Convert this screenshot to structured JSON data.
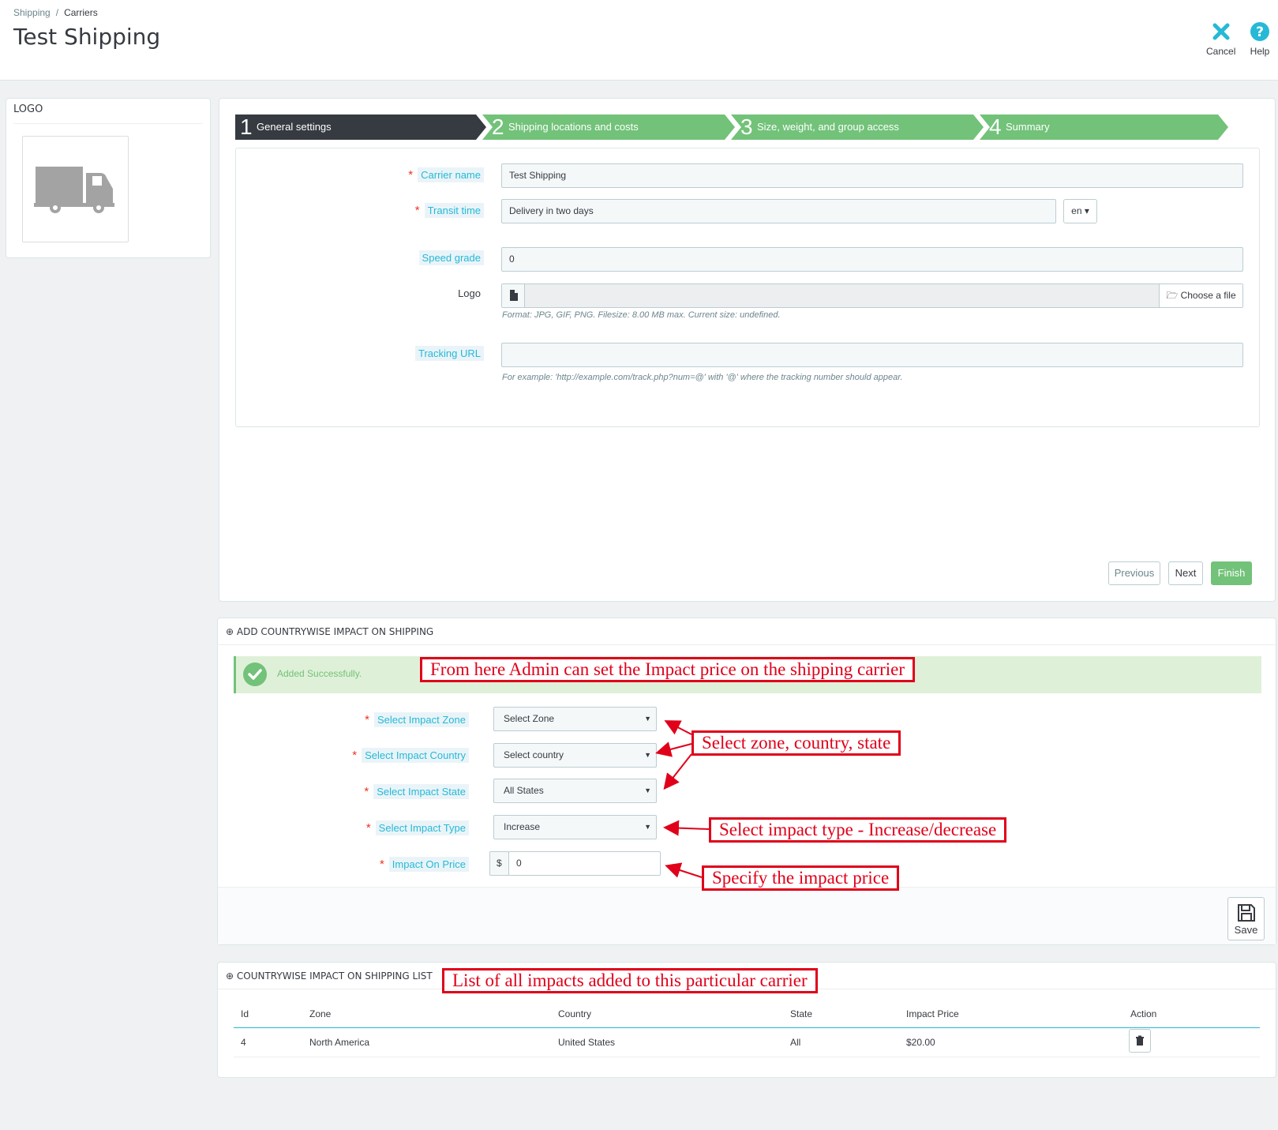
{
  "header": {
    "breadcrumb": [
      "Shipping",
      "Carriers"
    ],
    "breadcrumb_sep": "/",
    "title": "Test Shipping",
    "cancel_label": "Cancel",
    "help_label": "Help"
  },
  "logo_panel": {
    "title": "LOGO",
    "icon": "truck-icon"
  },
  "steps": [
    {
      "num": "1",
      "label": "General settings"
    },
    {
      "num": "2",
      "label": "Shipping locations and costs"
    },
    {
      "num": "3",
      "label": "Size, weight, and group access"
    },
    {
      "num": "4",
      "label": "Summary"
    }
  ],
  "form": {
    "carrier_name_label": "Carrier name",
    "carrier_name_value": "Test Shipping",
    "transit_time_label": "Transit time",
    "transit_time_value": "Delivery in two days",
    "lang": "en",
    "speed_grade_label": "Speed grade",
    "speed_grade_value": "0",
    "logo_label": "Logo",
    "choose_file": "Choose a file",
    "logo_hint": "Format: JPG, GIF, PNG. Filesize: 8.00 MB max. Current size: undefined.",
    "tracking_label": "Tracking URL",
    "tracking_value": "",
    "tracking_hint": "For example: 'http://example.com/track.php?num=@' with '@' where the tracking number should appear."
  },
  "wizard_buttons": {
    "previous": "Previous",
    "next": "Next",
    "finish": "Finish"
  },
  "impact": {
    "title": "ADD COUNTRYWISE IMPACT ON SHIPPING",
    "alert": "Added Successfully.",
    "zone_label": "Select Impact Zone",
    "zone_value": "Select Zone",
    "country_label": "Select Impact Country",
    "country_value": "Select country",
    "state_label": "Select Impact State",
    "state_value": "All States",
    "type_label": "Select Impact Type",
    "type_value": "Increase",
    "price_label": "Impact On Price",
    "currency": "$",
    "price_value": "0",
    "save": "Save"
  },
  "list": {
    "title": "COUNTRYWISE IMPACT ON SHIPPING LIST",
    "columns": [
      "Id",
      "Zone",
      "Country",
      "State",
      "Impact Price",
      "Action"
    ],
    "rows": [
      {
        "id": "4",
        "zone": "North America",
        "country": "United States",
        "state": "All",
        "price": "$20.00"
      }
    ]
  },
  "annotations": {
    "impact_note": "From here Admin can set the Impact price on the shipping carrier",
    "zone_note": "Select zone, country, state",
    "type_note": "Select impact type -  Increase/decrease",
    "price_note": "Specify the impact price",
    "list_note": "List of all impacts added to this particular carrier"
  },
  "colors": {
    "accent": "#25b9d7",
    "success": "#72c279",
    "dark": "#363a41",
    "annotation": "#e0001a"
  }
}
